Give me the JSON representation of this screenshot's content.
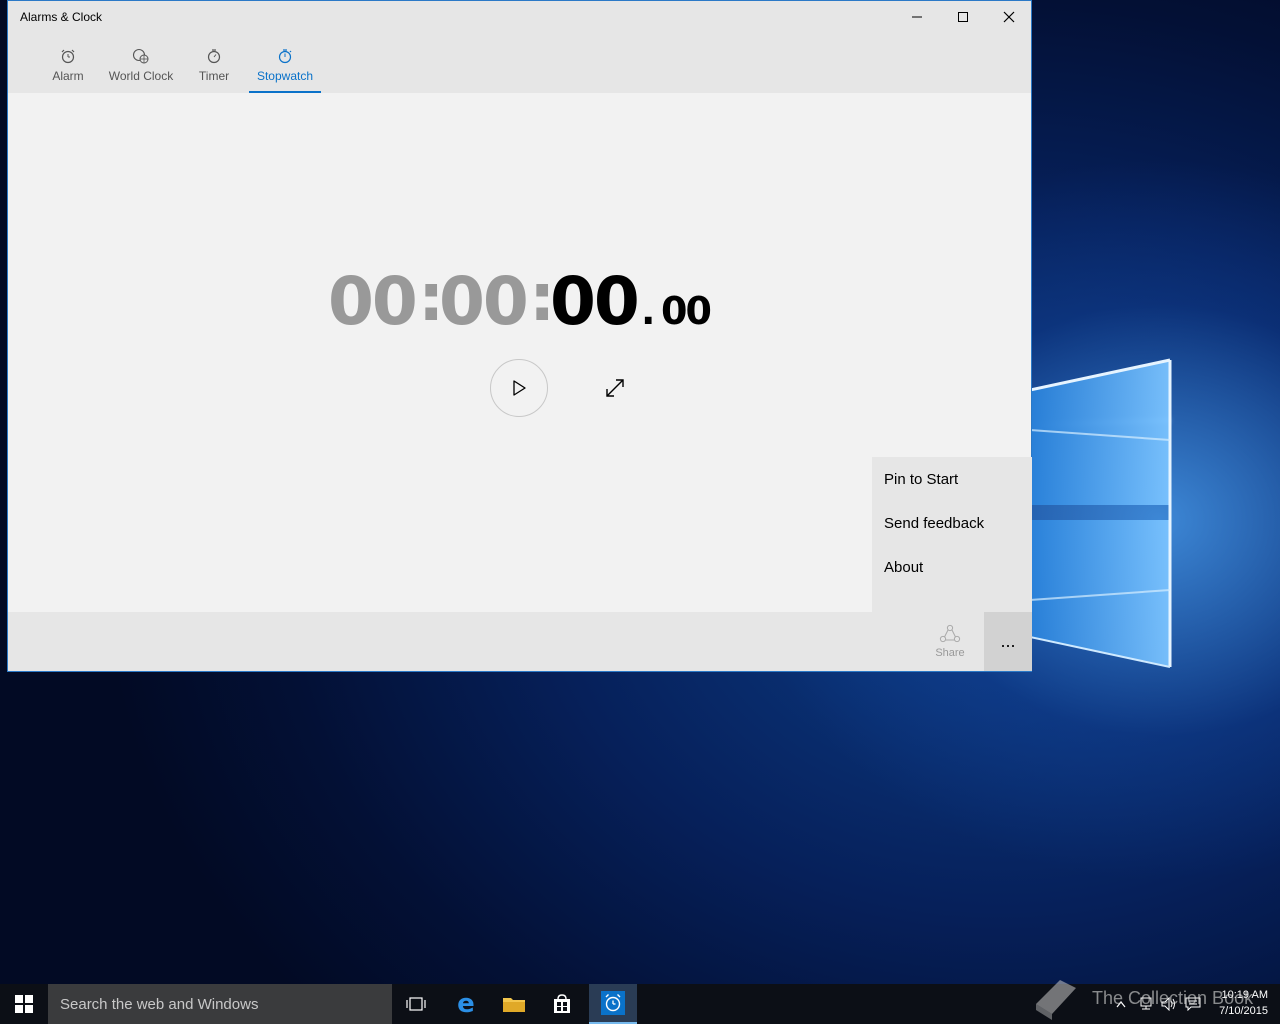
{
  "window": {
    "title": "Alarms & Clock",
    "controls": {
      "minimize": "minimize-icon",
      "maximize": "maximize-icon",
      "close": "close-icon"
    }
  },
  "tabs": [
    {
      "label": "Alarm",
      "icon": "alarm-icon"
    },
    {
      "label": "World Clock",
      "icon": "globe-icon"
    },
    {
      "label": "Timer",
      "icon": "timer-icon"
    },
    {
      "label": "Stopwatch",
      "icon": "stopwatch-icon",
      "selected": true
    }
  ],
  "stopwatch": {
    "hours": "00",
    "sep1": ":",
    "minutes": "00",
    "sep2": ":",
    "seconds": "00",
    "dot": ".",
    "hundredths": "00"
  },
  "menu": {
    "items": [
      "Pin to Start",
      "Send feedback",
      "About"
    ]
  },
  "commandbar": {
    "share_label": "Share",
    "more_label": "..."
  },
  "taskbar": {
    "search_placeholder": "Search the web and Windows",
    "time": "10:19 AM",
    "date": "7/10/2015"
  },
  "watermark": "The Collection Book",
  "colors": {
    "accent": "#0a72c9",
    "window_border": "#2b79c7",
    "gray_digits": "#999999"
  }
}
